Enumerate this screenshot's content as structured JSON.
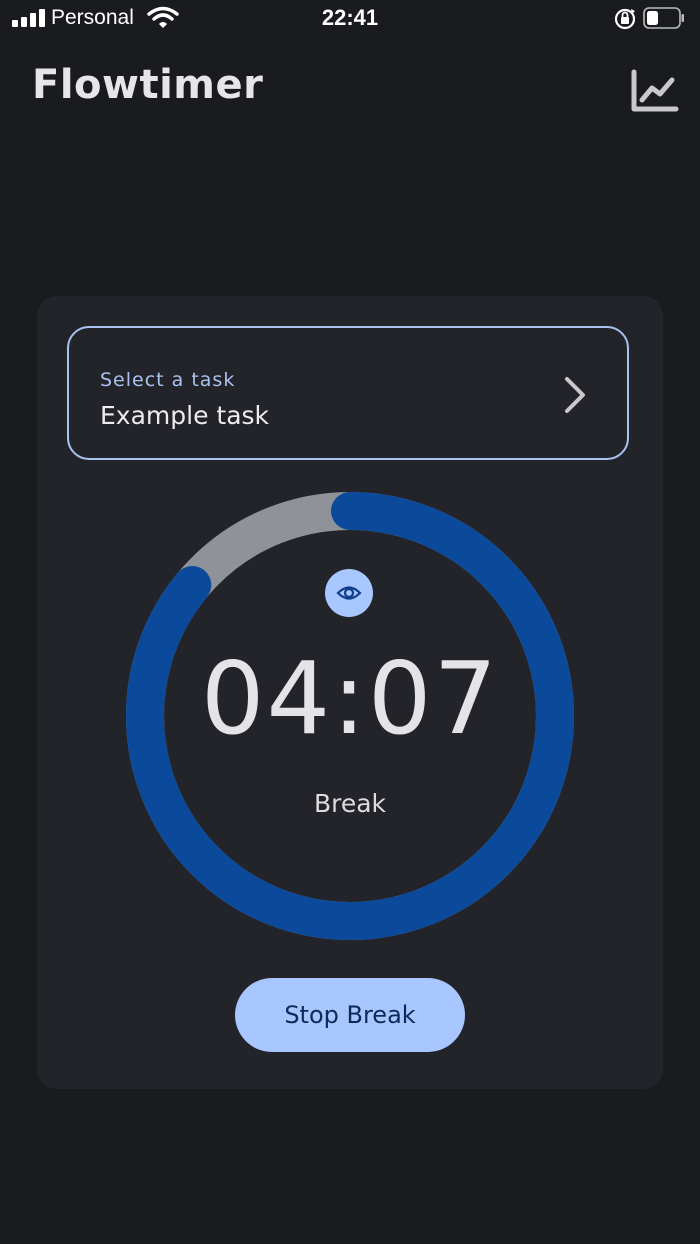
{
  "status_bar": {
    "carrier": "Personal",
    "time": "22:41",
    "icons": [
      "signal-icon",
      "wifi-icon",
      "rotation-lock-icon",
      "battery-icon"
    ]
  },
  "app_bar": {
    "title": "Flowtimer",
    "stats_icon": "line-chart-icon"
  },
  "task_selector": {
    "label": "Select a task",
    "value": "Example task",
    "icon": "chevron-right-icon"
  },
  "timer": {
    "time": "04:07",
    "mode": "Break",
    "visibility_icon": "eye-icon",
    "progress_fraction": 0.86
  },
  "actions": {
    "stop_label": "Stop Break"
  },
  "colors": {
    "background": "#1a1b1f",
    "card": "#232429",
    "accent": "#a8c6ff",
    "ring_progress": "#0b4a9a",
    "ring_track": "#8f9299"
  }
}
